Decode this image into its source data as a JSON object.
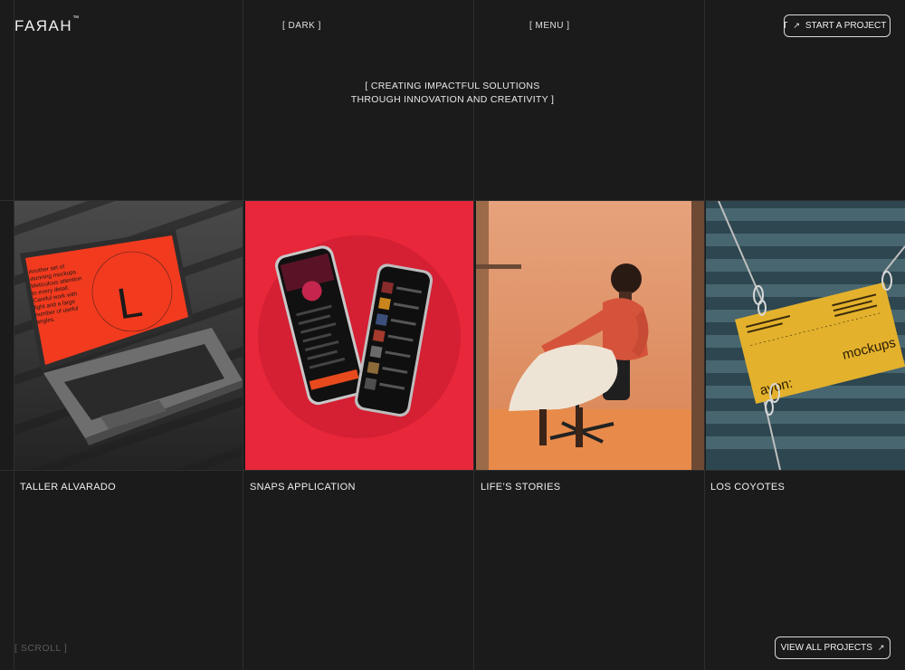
{
  "header": {
    "logo": "FAЯAH",
    "logo_tm": "™",
    "theme_toggle": "[ DARK ]",
    "menu": "[ MENU ]",
    "cta_fragment": "CT",
    "cta_label": "START A PROJECT"
  },
  "hero": {
    "line1": "[ CREATING IMPACTFUL SOLUTIONS",
    "line2": "THROUGH INNOVATION AND CREATIVITY ]"
  },
  "projects": [
    {
      "title": "TALLER ALVARADO",
      "screen_text": "Another set of stunning mockups. Meticulous attention to every detail. Careful work with light and a large number of useful angles.",
      "screen_letter": "L"
    },
    {
      "title": "SNAPS APPLICATION"
    },
    {
      "title": "LIFE’S STORIES"
    },
    {
      "title": "LOS COYOTES",
      "card_brand": "ayon:",
      "card_word": "mockups"
    }
  ],
  "footer": {
    "scroll": "[ SCROLL ]",
    "view_all": "VIEW ALL PROJECTS"
  },
  "colors": {
    "background": "#1b1b1b",
    "grid_line": "#2e2e2e",
    "accent_red": "#e8273b",
    "laptop_screen": "#f23a1e",
    "card_yellow": "#e3b12c"
  }
}
